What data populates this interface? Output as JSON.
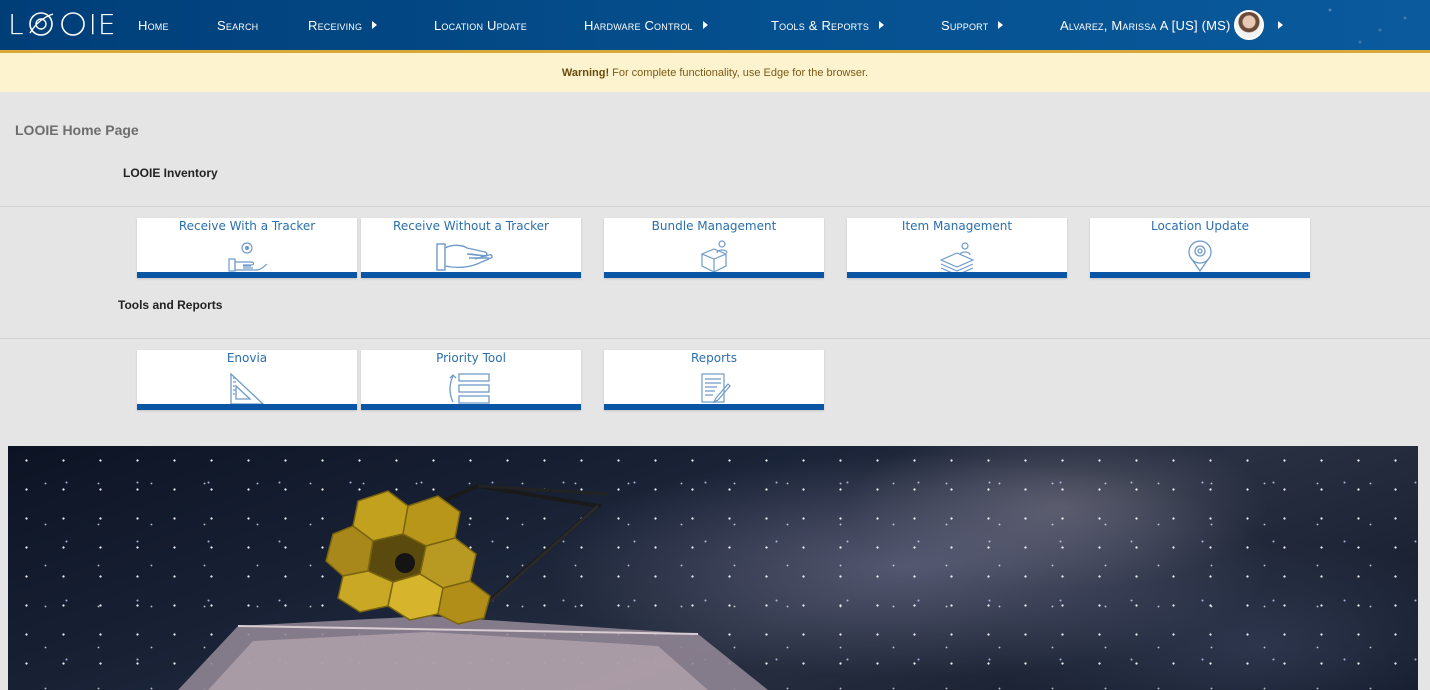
{
  "app": {
    "logo_text_left": "L",
    "logo_text_right": "IE",
    "brand_color": "#003e78",
    "accent_color": "#d9a83a",
    "tile_bar_color": "#0a56a4"
  },
  "nav": {
    "items": [
      {
        "label": "Home",
        "has_caret": false
      },
      {
        "label": "Search",
        "has_caret": false
      },
      {
        "label": "Receiving",
        "has_caret": true
      },
      {
        "label": "Location Update",
        "has_caret": false
      },
      {
        "label": "Hardware Control",
        "has_caret": true
      },
      {
        "label": "Tools & Reports",
        "has_caret": true
      },
      {
        "label": "Support",
        "has_caret": true
      }
    ],
    "user": {
      "label": "Alvarez, Marissa A [US] (MS)",
      "has_caret": true
    }
  },
  "warning": {
    "strong": "Warning!",
    "text": "For complete functionality, use Edge for the browser."
  },
  "page": {
    "title": "LOOIE Home Page"
  },
  "sections": [
    {
      "heading": "LOOIE Inventory",
      "tiles": [
        {
          "label": "Receive With a Tracker",
          "icon": "hand-tracker-icon"
        },
        {
          "label": "Receive Without a Tracker",
          "icon": "open-hand-icon"
        },
        {
          "label": "Bundle Management",
          "icon": "box-user-icon"
        },
        {
          "label": "Item Management",
          "icon": "stacked-items-icon"
        },
        {
          "label": "Location Update",
          "icon": "location-pin-icon"
        }
      ]
    },
    {
      "heading": "Tools and Reports",
      "tiles": [
        {
          "label": "Enovia",
          "icon": "set-square-icon"
        },
        {
          "label": "Priority Tool",
          "icon": "priority-list-icon"
        },
        {
          "label": "Reports",
          "icon": "report-document-icon"
        }
      ]
    }
  ]
}
